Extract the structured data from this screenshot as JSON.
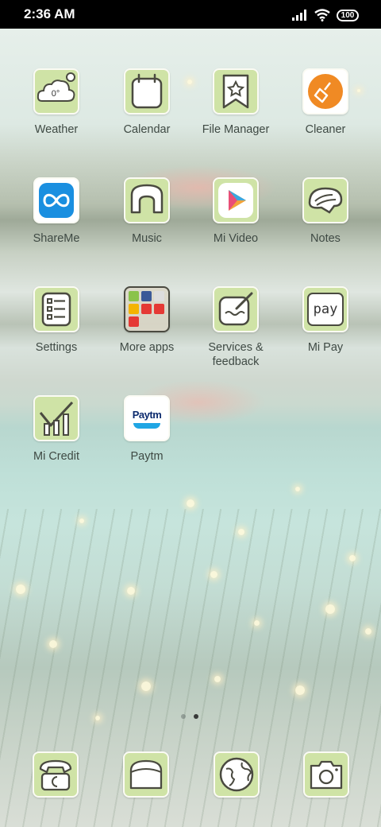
{
  "status_bar": {
    "time": "2:36 AM",
    "battery": "100",
    "icons": [
      "signal-icon",
      "wifi-icon",
      "battery-icon"
    ]
  },
  "apps": {
    "weather": {
      "label": "Weather",
      "temp": "0°"
    },
    "calendar": {
      "label": "Calendar"
    },
    "file_manager": {
      "label": "File Manager"
    },
    "cleaner": {
      "label": "Cleaner"
    },
    "shareme": {
      "label": "ShareMe"
    },
    "music": {
      "label": "Music"
    },
    "mi_video": {
      "label": "Mi Video"
    },
    "notes": {
      "label": "Notes"
    },
    "settings": {
      "label": "Settings"
    },
    "more_apps": {
      "label": "More apps"
    },
    "services": {
      "label": "Services &\nfeedback"
    },
    "mi_pay": {
      "label": "Mi Pay",
      "icon_text": "pay"
    },
    "mi_credit": {
      "label": "Mi Credit"
    },
    "paytm": {
      "label": "Paytm",
      "icon_text": "Paytm"
    }
  },
  "dock": [
    "phone-icon",
    "messages-icon",
    "browser-icon",
    "camera-icon"
  ],
  "pages": {
    "count": 2,
    "active": 1
  },
  "colors": {
    "tile": "#cfe3a6",
    "label": "#3f4a44",
    "cleaner": "#f08a24",
    "shareme": "#1a8fe0"
  }
}
